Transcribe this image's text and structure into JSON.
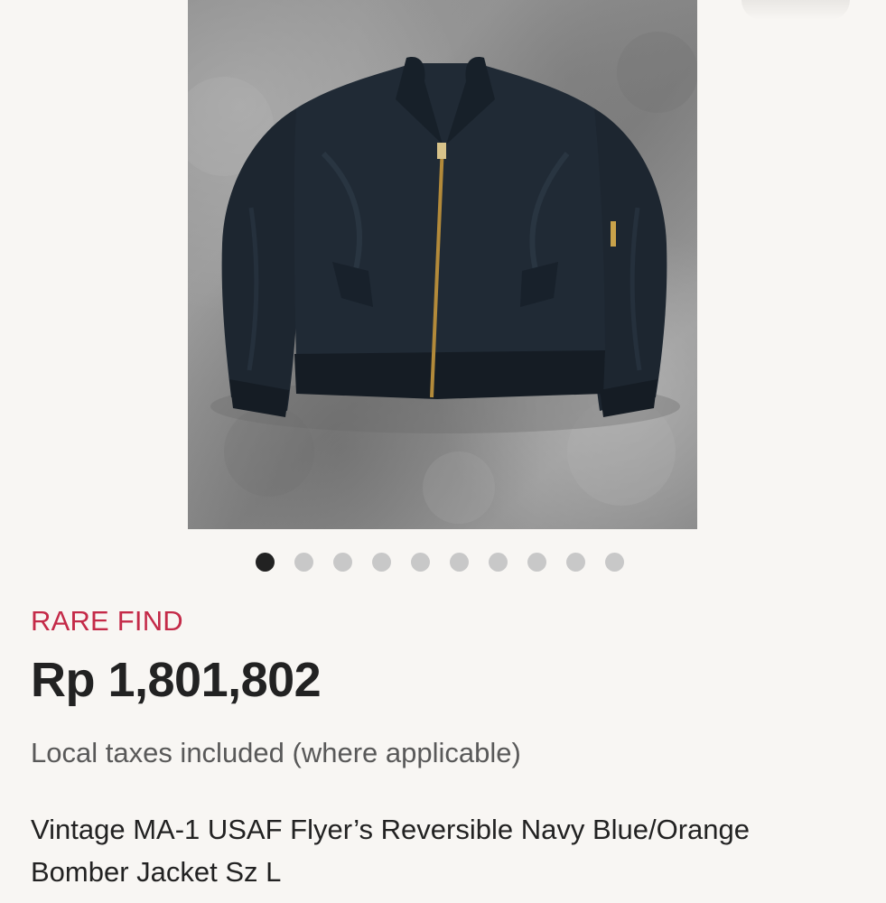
{
  "product": {
    "image_icon": "bomber-jacket-photo",
    "badge": "RARE FIND",
    "price": "Rp 1,801,802",
    "tax_note": "Local taxes included (where applicable)",
    "title": "Vintage MA-1 USAF Flyer’s Reversible Navy Blue/Orange Bomber Jacket Sz L"
  },
  "carousel": {
    "total": 10,
    "active_index": 0
  },
  "colors": {
    "badge": "#c42a48",
    "price": "#222222",
    "secondary_text": "#595959",
    "dot_active": "#222222",
    "dot_inactive": "#c8c8c8",
    "jacket": "#1d2630",
    "lining": "#f2661a"
  }
}
